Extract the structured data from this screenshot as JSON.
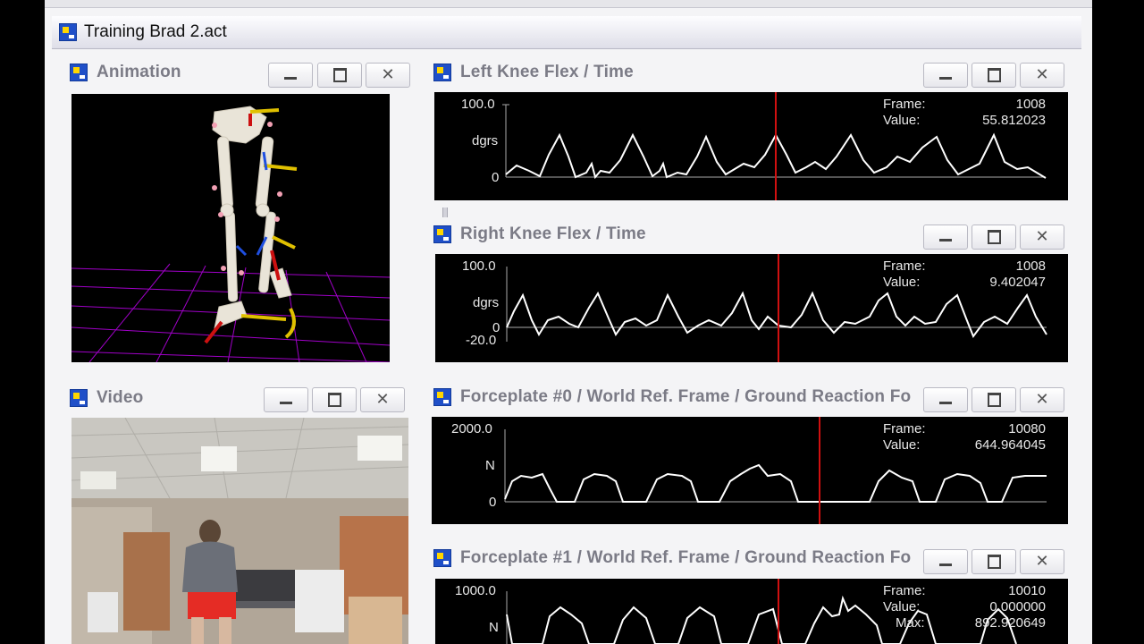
{
  "app": {
    "title": "Training Brad 2.act"
  },
  "animation": {
    "title": "Animation",
    "slider_position": 0.37
  },
  "video": {
    "title": "Video"
  },
  "plots": [
    {
      "id": "left-knee",
      "title": "Left Knee Flex / Time",
      "y_max": "100.0",
      "y_zero": "0",
      "unit": "dgrs",
      "frame_label": "Frame:",
      "frame_value": "1008",
      "value_label": "Value:",
      "value_value": "55.812023"
    },
    {
      "id": "right-knee",
      "title": "Right Knee Flex / Time",
      "y_max": "100.0",
      "y_zero": "0",
      "y_min": "-20.0",
      "unit": "dgrs",
      "frame_label": "Frame:",
      "frame_value": "1008",
      "value_label": "Value:",
      "value_value": "9.402047"
    },
    {
      "id": "forceplate-0",
      "title": "Forceplate #0 / World Ref. Frame / Ground Reaction Fo",
      "y_max": "2000.0",
      "y_zero": "0",
      "unit": "N",
      "frame_label": "Frame:",
      "frame_value": "10080",
      "value_label": "Value:",
      "value_value": "644.964045"
    },
    {
      "id": "forceplate-1",
      "title": "Forceplate #1 / World Ref. Frame / Ground Reaction Fo",
      "y_max": "1000.0",
      "unit": "N",
      "frame_label": "Frame:",
      "frame_value": "10010",
      "value_label": "Value:",
      "value_value": "0.000000",
      "max_label": "Max:",
      "max_value": "892.920649"
    }
  ],
  "colors": {
    "cursor": "#d01010",
    "trace": "#ffffff",
    "plot_bg": "#000000",
    "grid": "#a000c8"
  },
  "icons": {
    "window": "app-window-icon",
    "minimize": "minimize-icon",
    "maximize": "maximize-icon",
    "close": "close-icon"
  }
}
